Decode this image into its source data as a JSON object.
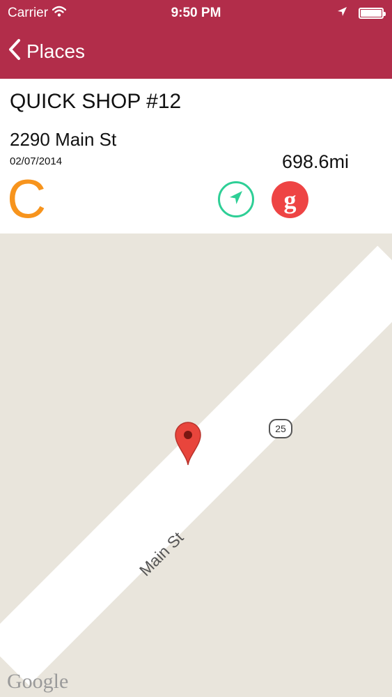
{
  "status_bar": {
    "carrier": "Carrier",
    "time": "9:50 PM",
    "battery_level": 1.0
  },
  "nav": {
    "back_label": "Places"
  },
  "place": {
    "name": "QUICK SHOP #12",
    "address": "2290 Main St",
    "date": "02/07/2014",
    "distance": "698.6mi",
    "grade": "C"
  },
  "actions": {
    "google_label": "g"
  },
  "map": {
    "road_label": "Main St",
    "route_number": "25",
    "attribution": "Google"
  },
  "colors": {
    "header": "#b22d4a",
    "grade": "#f7941d",
    "navigate": "#2ecf96",
    "google": "#ee4444",
    "map_bg": "#e9e5dc",
    "pin": "#e8453c"
  }
}
